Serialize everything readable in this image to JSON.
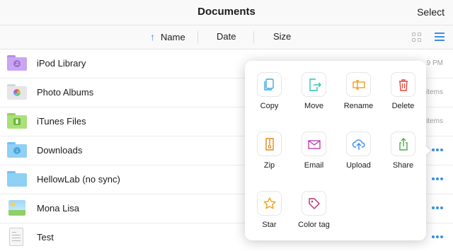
{
  "header": {
    "title": "Documents",
    "select_label": "Select"
  },
  "sort": {
    "name_label": "Name",
    "date_label": "Date",
    "size_label": "Size"
  },
  "files": [
    {
      "name": "iPod Library",
      "meta": "9 PM",
      "icon": "music-folder-icon"
    },
    {
      "name": "Photo Albums",
      "meta": "items",
      "icon": "photos-folder-icon"
    },
    {
      "name": "iTunes Files",
      "meta": "items",
      "icon": "itunes-folder-icon"
    },
    {
      "name": "Downloads",
      "meta": "",
      "icon": "downloads-folder-icon"
    },
    {
      "name": "HellowLab (no sync)",
      "meta": "",
      "icon": "folder-icon"
    },
    {
      "name": "Mona Lisa",
      "meta": "",
      "icon": "image-file-icon"
    },
    {
      "name": "Test",
      "meta": "",
      "icon": "text-file-icon"
    }
  ],
  "actions": [
    {
      "label": "Copy",
      "icon": "copy-icon",
      "color": "#3aa8e0"
    },
    {
      "label": "Move",
      "icon": "move-icon",
      "color": "#2ec4b6"
    },
    {
      "label": "Rename",
      "icon": "rename-icon",
      "color": "#f0a020"
    },
    {
      "label": "Delete",
      "icon": "trash-icon",
      "color": "#e8453c"
    },
    {
      "label": "Zip",
      "icon": "zip-icon",
      "color": "#e08a20"
    },
    {
      "label": "Email",
      "icon": "email-icon",
      "color": "#c040b0"
    },
    {
      "label": "Upload",
      "icon": "upload-cloud-icon",
      "color": "#3a8ee8"
    },
    {
      "label": "Share",
      "icon": "share-icon",
      "color": "#4cae4c"
    },
    {
      "label": "Star",
      "icon": "star-icon",
      "color": "#f0a020"
    },
    {
      "label": "Color tag",
      "icon": "tag-icon",
      "color": "#b0306a"
    }
  ],
  "colors": {
    "accent": "#3a8ee8",
    "folder_purple": "#c9a6f2",
    "folder_blue": "#8fd0f5",
    "folder_green": "#a9e07a"
  }
}
